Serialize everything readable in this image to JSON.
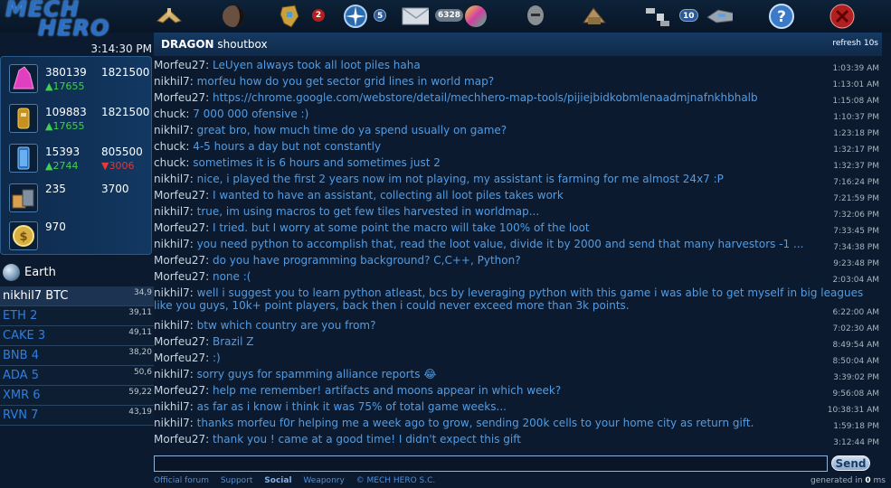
{
  "app": {
    "logo_line1": "MECH",
    "logo_line2": "HERO",
    "clock": "3:14:30 PM"
  },
  "nav": {
    "icons": [
      {
        "name": "ship-icon",
        "badge": ""
      },
      {
        "name": "moon-icon",
        "badge": ""
      },
      {
        "name": "robot-icon",
        "badge": "2"
      },
      {
        "name": "compass-icon",
        "badge": "5"
      },
      {
        "name": "mail-icon",
        "badge": "6328"
      },
      {
        "name": "color-orb-icon",
        "badge": ""
      },
      {
        "name": "helmet-icon",
        "badge": ""
      },
      {
        "name": "building-icon",
        "badge": ""
      },
      {
        "name": "satellite-icon",
        "badge": "10"
      },
      {
        "name": "drone-icon",
        "badge": ""
      },
      {
        "name": "help-icon",
        "badge": ""
      },
      {
        "name": "close-icon",
        "badge": ""
      }
    ]
  },
  "resources": [
    {
      "icon": "crystal-icon",
      "a": "380139",
      "b": "1821500",
      "up": "▲17655",
      "down": ""
    },
    {
      "icon": "fuel-icon",
      "a": "109883",
      "b": "1821500",
      "up": "▲17655",
      "down": ""
    },
    {
      "icon": "energy-icon",
      "a": "15393",
      "b": "805500",
      "up": "▲2744",
      "down": "▼3006"
    },
    {
      "icon": "cells-icon",
      "a": "235",
      "b": "3700",
      "up": "",
      "down": ""
    },
    {
      "icon": "gold-coin-icon",
      "a": "970",
      "b": "",
      "up": "",
      "down": ""
    }
  ],
  "earth": {
    "label": "Earth"
  },
  "coins": [
    {
      "name": "nikhil7 BTC",
      "value": "34,9"
    },
    {
      "name": "ETH 2",
      "value": "39,11"
    },
    {
      "name": "CAKE 3",
      "value": "49,11"
    },
    {
      "name": "BNB 4",
      "value": "38,20"
    },
    {
      "name": "ADA 5",
      "value": "50,6"
    },
    {
      "name": "XMR 6",
      "value": "59,22"
    },
    {
      "name": "RVN 7",
      "value": "43,19"
    }
  ],
  "chat": {
    "title_bold": "DRAGON",
    "title_rest": " shoutbox",
    "refresh": "refresh 10s",
    "messages": [
      {
        "user": "Morfeu27:",
        "text": " LeUyen always took all loot piles haha",
        "time": "1:03:39 AM"
      },
      {
        "user": "nikhil7:",
        "text": " morfeu how do you get sector grid lines in world map?",
        "time": "1:13:01 AM"
      },
      {
        "user": "Morfeu27:",
        "text": " https://chrome.google.com/webstore/detail/mechhero-map-tools/pijiejbidkobmlenaadmjnafnkhbhalb",
        "time": "1:15:08 AM"
      },
      {
        "user": "chuck:",
        "text": " 7 000 000 ofensive :)",
        "time": "1:10:37 PM"
      },
      {
        "user": "nikhil7:",
        "text": " great bro, how much time do ya spend usually on game?",
        "time": "1:23:18 PM"
      },
      {
        "user": "chuck:",
        "text": " 4-5 hours a day but not constantly",
        "time": "1:32:17 PM"
      },
      {
        "user": "chuck:",
        "text": " sometimes it is 6 hours and sometimes just 2",
        "time": "1:32:37 PM"
      },
      {
        "user": "nikhil7:",
        "text": " nice, i played the first 2 years now im not playing, my assistant is farming for me almost 24x7 :P",
        "time": "7:16:24 PM"
      },
      {
        "user": "Morfeu27:",
        "text": " I wanted to have an assistant, collecting all loot piles takes work",
        "time": "7:21:59 PM"
      },
      {
        "user": "nikhil7:",
        "text": " true, im using macros to get few tiles harvested in worldmap...",
        "time": "7:32:06 PM"
      },
      {
        "user": "Morfeu27:",
        "text": " I tried. but I worry at some point the macro will take 100% of the loot",
        "time": "7:33:45 PM"
      },
      {
        "user": "nikhil7:",
        "text": " you need python to accomplish that, read the loot value, divide it by 2000 and send that many harvestors -1 ...",
        "time": "7:34:38 PM"
      },
      {
        "user": "Morfeu27:",
        "text": " do you have programming background? C,C++, Python?",
        "time": "9:23:48 PM"
      },
      {
        "user": "Morfeu27:",
        "text": " none :(",
        "time": "2:03:04 AM"
      },
      {
        "user": "nikhil7:",
        "text": " well i suggest you to learn python atleast, bcs by leveraging python with this game i was able to get myself in big leagues like you guys, 10k+ point players, back then i could never exceed more than 3k points.",
        "time": "6:22:00 AM"
      },
      {
        "user": "nikhil7:",
        "text": " btw which country are you from?",
        "time": "7:02:30 AM"
      },
      {
        "user": "Morfeu27:",
        "text": " Brazil Z",
        "time": "8:49:54 AM"
      },
      {
        "user": "Morfeu27:",
        "text": " :)",
        "time": "8:50:04 AM"
      },
      {
        "user": "nikhil7:",
        "text": " sorry guys for spamming alliance reports 😂",
        "time": "3:39:02 PM"
      },
      {
        "user": "Morfeu27:",
        "text": " help me remember! artifacts and moons appear in which week?",
        "time": "9:56:08 AM"
      },
      {
        "user": "nikhil7:",
        "text": " as far as i know i think it was 75% of total game weeks...",
        "time": "10:38:31 AM"
      },
      {
        "user": "nikhil7:",
        "text": " thanks morfeu f0r helping me a week ago to grow, sending 200k cells to your home city as return gift.",
        "time": "1:59:18 PM"
      },
      {
        "user": "Morfeu27:",
        "text": " thank you ! came at a good time! I didn't expect this gift",
        "time": "3:12:44 PM"
      }
    ],
    "input_value": "",
    "send_label": "Send"
  },
  "footer": {
    "links": [
      "Official forum",
      "Support",
      "Social",
      "Weaponry"
    ],
    "copyright": "© MECH HERO S.C.",
    "gen_prefix": "generated in ",
    "gen_value": "0",
    "gen_suffix": " ms"
  }
}
